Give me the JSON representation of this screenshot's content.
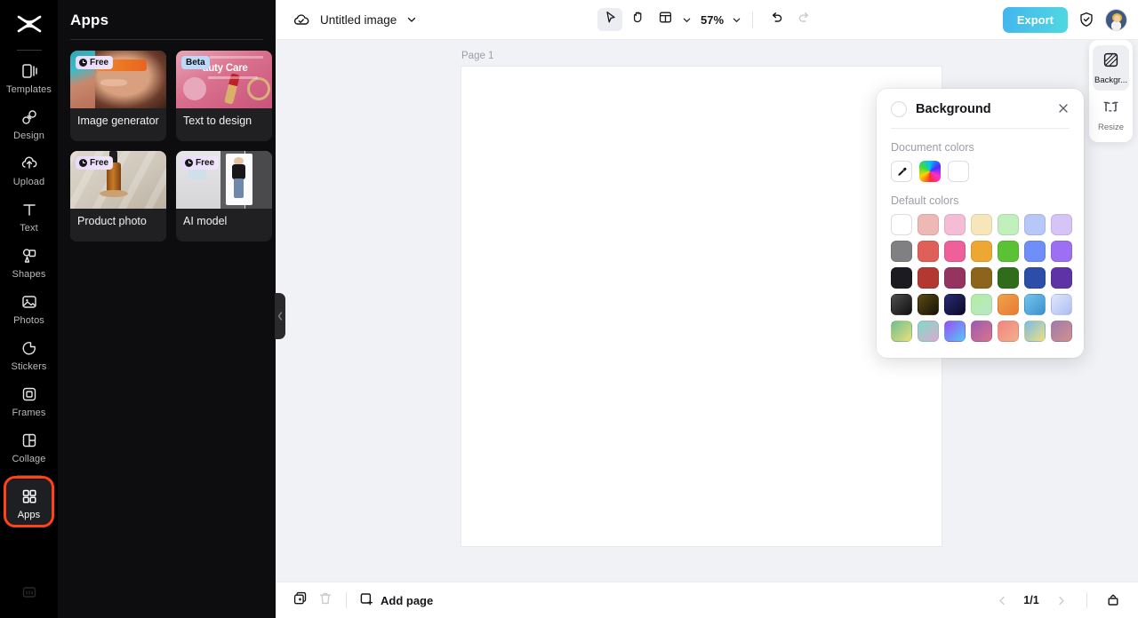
{
  "app": {
    "logo_icon": "capcut-logo-icon"
  },
  "rail": {
    "items": [
      {
        "label": "Templates",
        "icon": "templates-icon",
        "active": false
      },
      {
        "label": "Design",
        "icon": "design-icon",
        "active": false
      },
      {
        "label": "Upload",
        "icon": "upload-icon",
        "active": false
      },
      {
        "label": "Text",
        "icon": "text-icon",
        "active": false
      },
      {
        "label": "Shapes",
        "icon": "shapes-icon",
        "active": false
      },
      {
        "label": "Photos",
        "icon": "photos-icon",
        "active": false
      },
      {
        "label": "Stickers",
        "icon": "stickers-icon",
        "active": false
      },
      {
        "label": "Frames",
        "icon": "frames-icon",
        "active": false
      },
      {
        "label": "Collage",
        "icon": "collage-icon",
        "active": false
      },
      {
        "label": "Apps",
        "icon": "apps-grid-icon",
        "active": true
      }
    ],
    "selection_color": "#ff4218"
  },
  "apps_panel": {
    "title": "Apps",
    "cards": [
      {
        "name": "Image generator",
        "badge": "Free",
        "badge_type": "free",
        "selected": false
      },
      {
        "name": "Text to design",
        "badge": "Beta",
        "badge_type": "beta",
        "selected": false,
        "thumb_text": "auty Care"
      },
      {
        "name": "Product photo",
        "badge": "Free",
        "badge_type": "free",
        "selected": true
      },
      {
        "name": "AI model",
        "badge": "Free",
        "badge_type": "free",
        "selected": false
      }
    ],
    "collapse_icon": "chevron-left-icon"
  },
  "topbar": {
    "cloud_icon": "cloud-saved-icon",
    "doc_title": "Untitled image",
    "title_chevron_icon": "chevron-down-icon",
    "tools": [
      {
        "icon": "cursor-select-icon",
        "active": true
      },
      {
        "icon": "hand-pan-icon",
        "active": false
      },
      {
        "icon": "layout-grid-icon",
        "active": false
      }
    ],
    "layout_chevron_icon": "chevron-down-icon",
    "zoom_level": "57%",
    "zoom_chevron_icon": "chevron-down-icon",
    "undo_icon": "undo-icon",
    "redo_icon": "redo-icon",
    "export_label": "Export",
    "shield_icon": "shield-check-icon",
    "avatar_icon": "user-avatar"
  },
  "canvas": {
    "page_label": "Page 1"
  },
  "right_rail": {
    "items": [
      {
        "label": "Backgr...",
        "icon": "background-icon",
        "active": true
      },
      {
        "label": "Resize",
        "icon": "resize-icon",
        "active": false
      }
    ]
  },
  "background_panel": {
    "title": "Background",
    "close_icon": "close-icon",
    "document_colors_label": "Document colors",
    "document_colors": [
      {
        "type": "eyedropper",
        "icon": "eyedropper-icon"
      },
      {
        "type": "rainbow",
        "icon": "color-picker-icon"
      },
      {
        "type": "solid",
        "color": "#ffffff"
      }
    ],
    "default_colors_label": "Default colors",
    "default_colors": [
      [
        "#ffffff",
        "#eeb9b5",
        "#f4bdd5",
        "#f7e6b9",
        "#c2f0bd",
        "#b7c8f8",
        "#d6c4f7"
      ],
      [
        "#808083",
        "#df6059",
        "#ef5f99",
        "#eda833",
        "#5bc236",
        "#6f8ef8",
        "#9c6ff3"
      ],
      [
        "#1b1b21",
        "#b23831",
        "#95345f",
        "#8c641b",
        "#2f6d1d",
        "#2c4da8",
        "#5e33a6"
      ],
      [
        "#3a3a3a",
        "#6b551a",
        "#171647",
        "#9fe3a0",
        "#ec8e3f",
        "#52a6dc",
        "#c4cdf5"
      ],
      [
        "#8ec08a",
        "#8fdcc8",
        "#9a56f2",
        "#a45ca8",
        "#f2877f",
        "#79c2e8",
        "#a177a4"
      ]
    ],
    "default_colors_gradients": [
      [
        null,
        null,
        null,
        null,
        null,
        null,
        null
      ],
      [
        null,
        null,
        null,
        null,
        null,
        null,
        null
      ],
      [
        null,
        null,
        null,
        null,
        null,
        null,
        null
      ],
      [
        "linear-gradient(135deg,#4d4d4d,#101010)",
        "linear-gradient(135deg,#5b4a12,#161208)",
        "linear-gradient(135deg,#2a2a72,#0a0a2a)",
        "linear-gradient(135deg,#b2efa2,#b9e6c7)",
        "linear-gradient(135deg,#f0a24a,#e87a33)",
        "linear-gradient(135deg,#6fc6ea,#3f8fd0)",
        "linear-gradient(135deg,#dfe7fb,#aebdf2)"
      ],
      [
        "linear-gradient(135deg,#6fbf93,#e9e07a)",
        "linear-gradient(135deg,#7fdcc4,#dba9d2)",
        "linear-gradient(135deg,#9a4ef5,#56c7f5)",
        "linear-gradient(135deg,#9b5bb2,#d9748a)",
        "linear-gradient(135deg,#f2847f,#f3b08e)",
        "linear-gradient(135deg,#79bce8,#efe07f)",
        "linear-gradient(135deg,#a07ba8,#d19090)"
      ]
    ]
  },
  "bottombar": {
    "duplicate_icon": "duplicate-page-icon",
    "delete_icon": "trash-icon",
    "add_page_icon": "add-page-icon",
    "add_page_label": "Add page",
    "prev_icon": "chevron-left-icon",
    "page_indicator": "1/1",
    "next_icon": "chevron-right-icon",
    "grid_view_icon": "page-manager-icon"
  }
}
